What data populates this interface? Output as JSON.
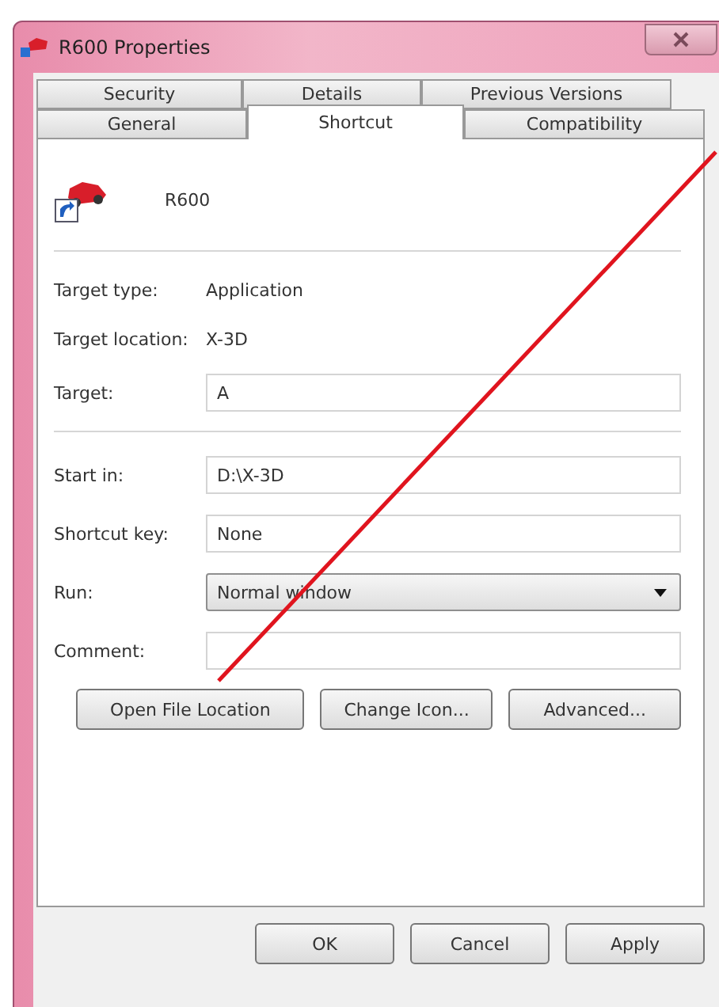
{
  "window": {
    "title": "R600 Properties"
  },
  "tabs": [
    [
      {
        "label": "Security",
        "selected": false
      },
      {
        "label": "Details",
        "selected": false
      },
      {
        "label": "Previous Versions",
        "selected": false
      }
    ],
    [
      {
        "label": "General",
        "selected": false
      },
      {
        "label": "Shortcut",
        "selected": true
      },
      {
        "label": "Compatibility",
        "selected": false
      }
    ]
  ],
  "shortcut_name": "R600",
  "rows": [
    {
      "kind": "info",
      "label": "Target type:",
      "value": "Application"
    },
    {
      "kind": "info",
      "label": "Target location:",
      "value": "X-3D"
    },
    {
      "kind": "field",
      "label": "Target:",
      "value": "A"
    },
    {
      "kind": "divider"
    },
    {
      "kind": "field",
      "label": "Start in:",
      "value": "D:\\X-3D"
    },
    {
      "kind": "field",
      "label": "Shortcut key:",
      "value": "None"
    },
    {
      "kind": "select",
      "label": "Run:",
      "value": "Normal window"
    },
    {
      "kind": "field",
      "label": "Comment:",
      "value": ""
    }
  ],
  "action_buttons": [
    "Open File Location",
    "Change Icon...",
    "Advanced..."
  ],
  "dialog_buttons": [
    "OK",
    "Cancel",
    "Apply"
  ]
}
